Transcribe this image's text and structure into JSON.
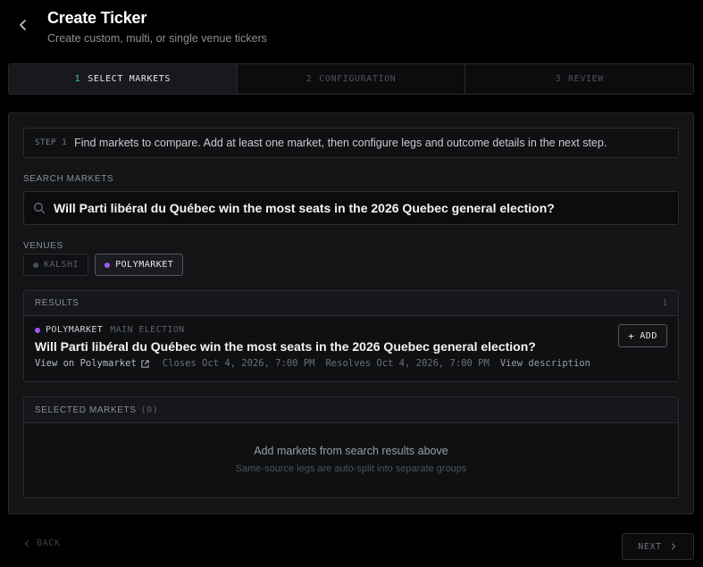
{
  "header": {
    "back_icon": "chevron-left-icon",
    "title": "Create Ticker",
    "subtitle": "Create custom, multi, or single venue tickers"
  },
  "stepper": {
    "steps": [
      {
        "num": "1",
        "label": "SELECT MARKETS",
        "active": true
      },
      {
        "num": "2",
        "label": "CONFIGURATION",
        "active": false
      },
      {
        "num": "3",
        "label": "REVIEW",
        "active": false
      }
    ]
  },
  "info": {
    "step_label": "STEP 1",
    "text": "Find markets to compare. Add at least one market, then configure legs and outcome details in the next step."
  },
  "search": {
    "label": "SEARCH MARKETS",
    "value": "Will Parti libéral du Québec win the most seats in the 2026 Quebec general election?"
  },
  "venues": {
    "label": "VENUES",
    "items": [
      {
        "label": "KALSHI",
        "active": false
      },
      {
        "label": "POLYMARKET",
        "active": true
      }
    ]
  },
  "results": {
    "label": "RESULTS",
    "count": "1",
    "items": [
      {
        "venue": "POLYMARKET",
        "group": "MAIN ELECTION",
        "title": "Will Parti libéral du Québec win the most seats in the 2026 Quebec general election?",
        "view_link": "View on Polymarket",
        "closes": "Closes Oct 4, 2026, 7:00 PM",
        "resolves": "Resolves Oct 4, 2026, 7:00 PM",
        "description_link": "View description",
        "add_label": "ADD"
      }
    ]
  },
  "selected": {
    "label": "SELECTED MARKETS",
    "count": "(0)",
    "empty_main": "Add markets from search results above",
    "empty_sub": "Same-source legs are auto-split into separate groups"
  },
  "footer": {
    "back_label": "BACK",
    "next_label": "NEXT"
  },
  "colors": {
    "background": "#000000",
    "accent_green": "#3ecf8e",
    "polymarket_purple": "#a855f7"
  }
}
